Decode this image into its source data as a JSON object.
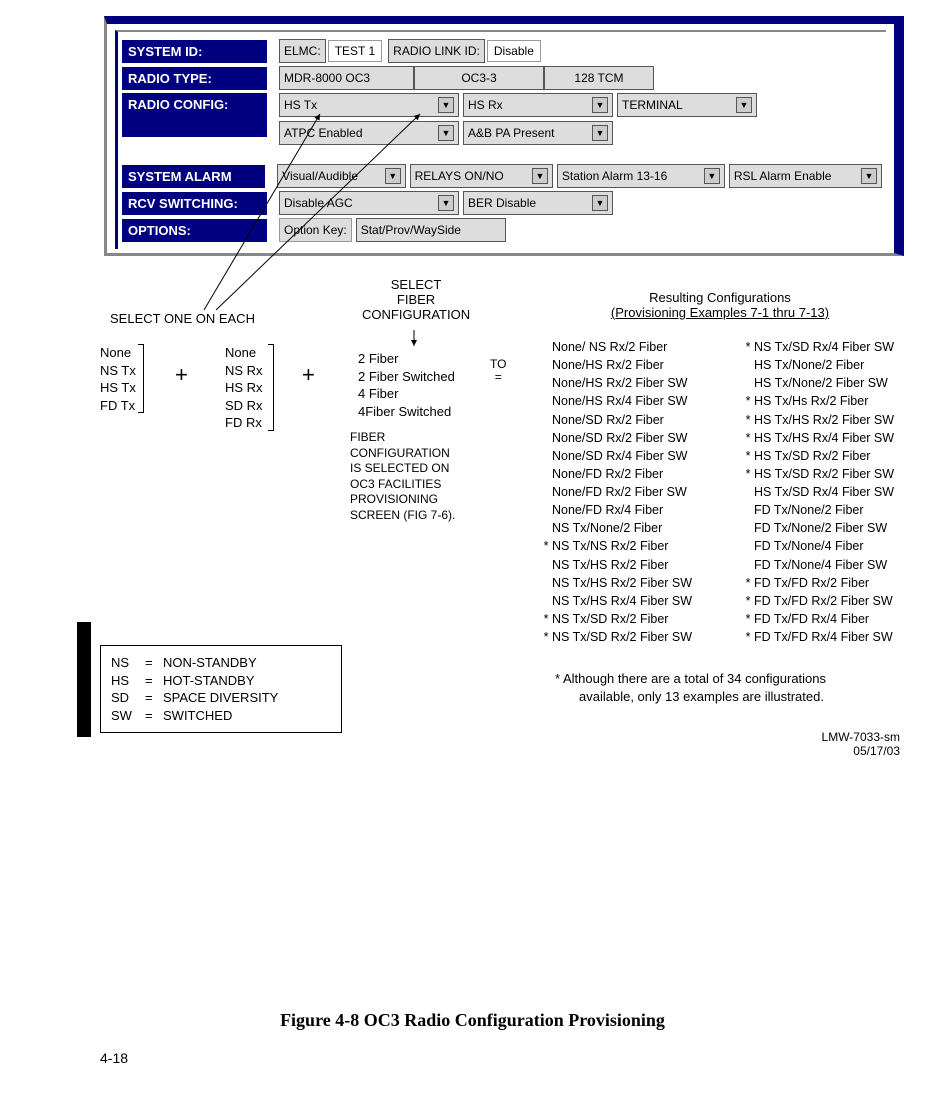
{
  "panel": {
    "labels": {
      "system_id": "SYSTEM ID:",
      "radio_type": "RADIO TYPE:",
      "radio_config": "RADIO CONFIG:",
      "system_alarm": "SYSTEM ALARM",
      "rcv_switching": "RCV SWITCHING:",
      "options": "OPTIONS:"
    },
    "system_id": {
      "elmc_label": "ELMC:",
      "elmc_value": "TEST 1",
      "rl_label": "RADIO LINK ID:",
      "rl_value": "Disable"
    },
    "radio_type": {
      "a": "MDR-8000 OC3",
      "b": "OC3-3",
      "c": "128 TCM"
    },
    "radio_config": {
      "tx": "HS Tx",
      "rx": "HS Rx",
      "terminal": "TERMINAL",
      "atpc": "ATPC Enabled",
      "pa": "A&B PA Present"
    },
    "system_alarm": {
      "va": "Visual/Audible",
      "relays": "RELAYS ON/NO",
      "station": "Station Alarm 13-16",
      "rsl": "RSL Alarm Enable"
    },
    "rcv_switching": {
      "agc": "Disable AGC",
      "ber": "BER Disable"
    },
    "options": {
      "key_label": "Option Key:",
      "key_value": "Stat/Prov/WaySide"
    }
  },
  "select_one": "SELECT ONE ON EACH",
  "tx_list": [
    "None",
    "NS Tx",
    "HS Tx",
    "FD Tx"
  ],
  "rx_list": [
    "None",
    "NS Rx",
    "HS Rx",
    "SD Rx",
    "FD Rx"
  ],
  "plus": "+",
  "fiber_header": {
    "l1": "SELECT",
    "l2": "FIBER",
    "l3": "CONFIGURATION"
  },
  "fiber_list": [
    "2 Fiber",
    "2 Fiber Switched",
    "4 Fiber",
    "4Fiber Switched"
  ],
  "to": {
    "l1": "TO",
    "l2": "="
  },
  "fiber_note": {
    "l1": "FIBER",
    "l2": "CONFIGURATION",
    "l3": "IS SELECTED ON",
    "l4": "OC3 FACILITIES",
    "l5": "PROVISIONING",
    "l6": "SCREEN (FIG 7-6)."
  },
  "results_title": {
    "l1": "Resulting Configurations",
    "l2": "(Provisioning  Examples 7-1 thru 7-13)"
  },
  "cfg_left": [
    {
      "s": "",
      "t": "None/ NS Rx/2 Fiber"
    },
    {
      "s": "",
      "t": "None/HS Rx/2 Fiber"
    },
    {
      "s": "",
      "t": "None/HS Rx/2 Fiber SW"
    },
    {
      "s": "",
      "t": "None/HS Rx/4 Fiber SW"
    },
    {
      "s": "",
      "t": "None/SD Rx/2 Fiber"
    },
    {
      "s": "",
      "t": "None/SD Rx/2 Fiber SW"
    },
    {
      "s": "",
      "t": "None/SD Rx/4 Fiber SW"
    },
    {
      "s": "",
      "t": "None/FD Rx/2 Fiber"
    },
    {
      "s": "",
      "t": "None/FD Rx/2 Fiber SW"
    },
    {
      "s": "",
      "t": "None/FD Rx/4 Fiber"
    },
    {
      "s": "",
      "t": "NS Tx/None/2 Fiber"
    },
    {
      "s": "*",
      "t": "NS Tx/NS Rx/2 Fiber"
    },
    {
      "s": "",
      "t": "NS Tx/HS Rx/2 Fiber"
    },
    {
      "s": "",
      "t": "NS Tx/HS Rx/2 Fiber SW"
    },
    {
      "s": "",
      "t": "NS Tx/HS Rx/4 Fiber SW"
    },
    {
      "s": "*",
      "t": "NS Tx/SD Rx/2 Fiber"
    },
    {
      "s": "*",
      "t": "NS Tx/SD Rx/2 Fiber SW"
    }
  ],
  "cfg_right": [
    {
      "s": "*",
      "t": "NS Tx/SD Rx/4 Fiber SW"
    },
    {
      "s": "",
      "t": "HS Tx/None/2 Fiber"
    },
    {
      "s": "",
      "t": "HS Tx/None/2 Fiber SW"
    },
    {
      "s": "*",
      "t": "HS Tx/Hs Rx/2 Fiber"
    },
    {
      "s": "*",
      "t": "HS Tx/HS Rx/2 Fiber SW"
    },
    {
      "s": "*",
      "t": "HS Tx/HS Rx/4 Fiber SW"
    },
    {
      "s": "*",
      "t": "HS Tx/SD Rx/2 Fiber"
    },
    {
      "s": "*",
      "t": "HS Tx/SD Rx/2 Fiber SW"
    },
    {
      "s": "",
      "t": "HS Tx/SD Rx/4 Fiber SW"
    },
    {
      "s": "",
      "t": "FD Tx/None/2 Fiber"
    },
    {
      "s": "",
      "t": "FD Tx/None/2 Fiber SW"
    },
    {
      "s": "",
      "t": "FD Tx/None/4 Fiber"
    },
    {
      "s": "",
      "t": "FD Tx/None/4 Fiber SW"
    },
    {
      "s": "*",
      "t": "FD Tx/FD Rx/2 Fiber"
    },
    {
      "s": "*",
      "t": "FD Tx/FD Rx/2 Fiber SW"
    },
    {
      "s": "*",
      "t": "FD Tx/FD Rx/4 Fiber"
    },
    {
      "s": "*",
      "t": "FD Tx/FD Rx/4 Fiber SW"
    }
  ],
  "legend": [
    {
      "a": "NS",
      "b": "=",
      "c": "NON-STANDBY"
    },
    {
      "a": "HS",
      "b": "=",
      "c": "HOT-STANDBY"
    },
    {
      "a": "SD",
      "b": "=",
      "c": "SPACE DIVERSITY"
    },
    {
      "a": "SW",
      "b": "=",
      "c": "SWITCHED"
    }
  ],
  "ast_note": {
    "l1": "*   Although there  are a total of 34 configurations",
    "l2": "available, only 13 examples are illustrated."
  },
  "doc_id": {
    "l1": "LMW-7033-sm",
    "l2": "05/17/03"
  },
  "caption": "Figure 4-8  OC3 Radio Configuration Provisioning",
  "page_number": "4-18"
}
